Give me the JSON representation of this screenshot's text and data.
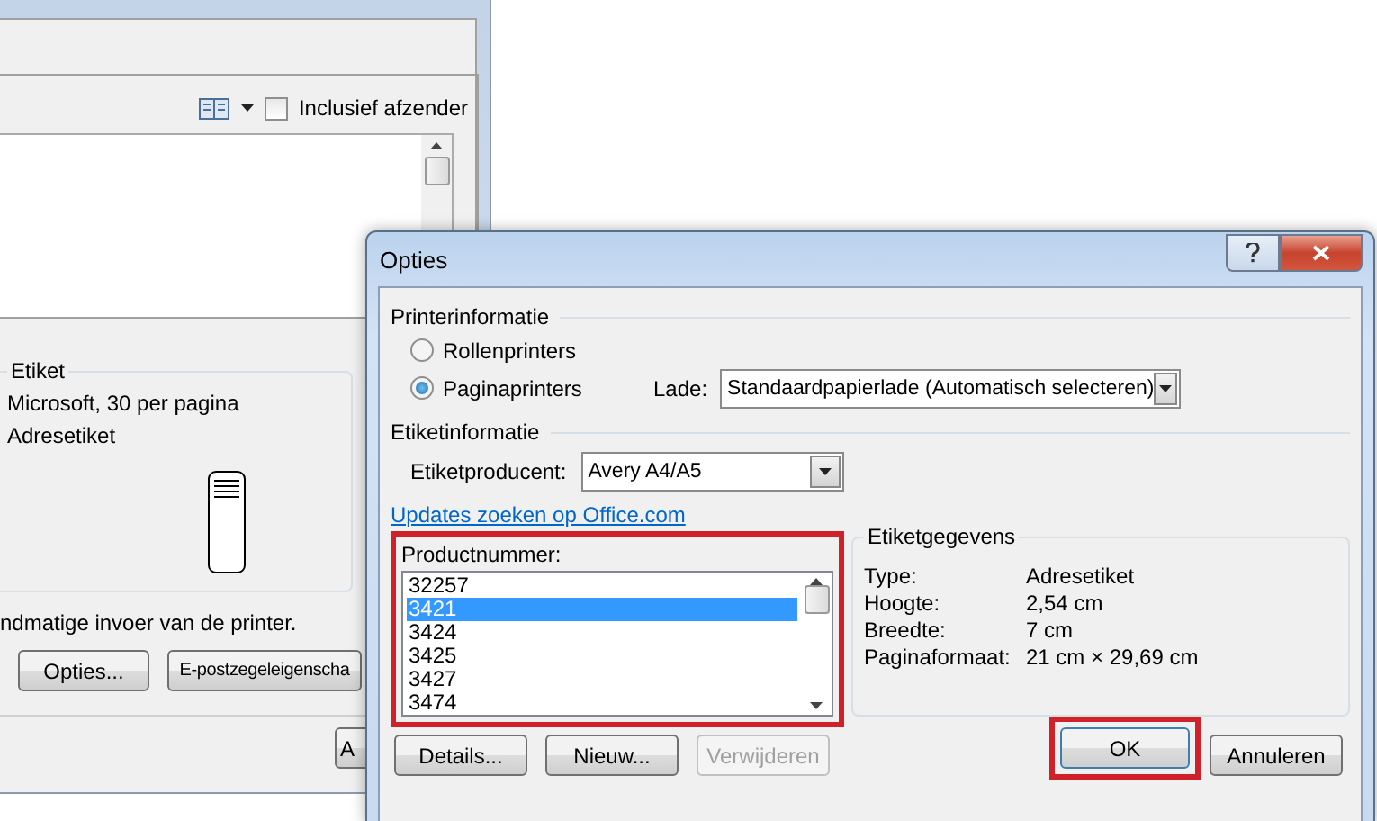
{
  "background_window": {
    "sender": {
      "label": "Inclusief afzender",
      "checked": false
    },
    "label_group": {
      "title": "Etiket",
      "lines": [
        "Microsoft, 30 per pagina",
        "Adresetiket"
      ]
    },
    "hint": "ndmatige invoer van de printer.",
    "buttons": [
      {
        "label": "Opties..."
      },
      {
        "label": "E-postzegeleigenscha"
      }
    ],
    "bottom_button": "A"
  },
  "dialog": {
    "title": "Opties",
    "printer_section": {
      "title": "Printerinformatie",
      "radios": [
        {
          "label": "Rollenprinters",
          "selected": false
        },
        {
          "label": "Paginaprinters",
          "selected": true
        }
      ],
      "tray_label": "Lade:",
      "tray_value": "Standaardpapierlade (Automatisch selecteren)"
    },
    "label_section": {
      "title": "Etiketinformatie",
      "vendor_label": "Etiketproducent:",
      "vendor_value": "Avery A4/A5"
    },
    "link": "Updates zoeken op Office.com",
    "product": {
      "label": "Productnummer:",
      "items": [
        {
          "text": "32257",
          "selected": false
        },
        {
          "text": "3421",
          "selected": true
        },
        {
          "text": "3424",
          "selected": false
        },
        {
          "text": "3425",
          "selected": false
        },
        {
          "text": "3427",
          "selected": false
        },
        {
          "text": "3474",
          "selected": false
        }
      ]
    },
    "details": {
      "title": "Etiketgegevens",
      "rows": [
        {
          "label": "Type:",
          "value": "Adresetiket"
        },
        {
          "label": "Hoogte:",
          "value": "2,54 cm"
        },
        {
          "label": "Breedte:",
          "value": "7 cm"
        },
        {
          "label": "Paginaformaat:",
          "value": "21 cm × 29,69 cm"
        }
      ]
    },
    "buttons": [
      {
        "label": "Details...",
        "disabled": false
      },
      {
        "label": "Nieuw...",
        "disabled": false
      },
      {
        "label": "Verwijderen",
        "disabled": true
      }
    ],
    "ok": "OK",
    "cancel": "Annuleren"
  }
}
